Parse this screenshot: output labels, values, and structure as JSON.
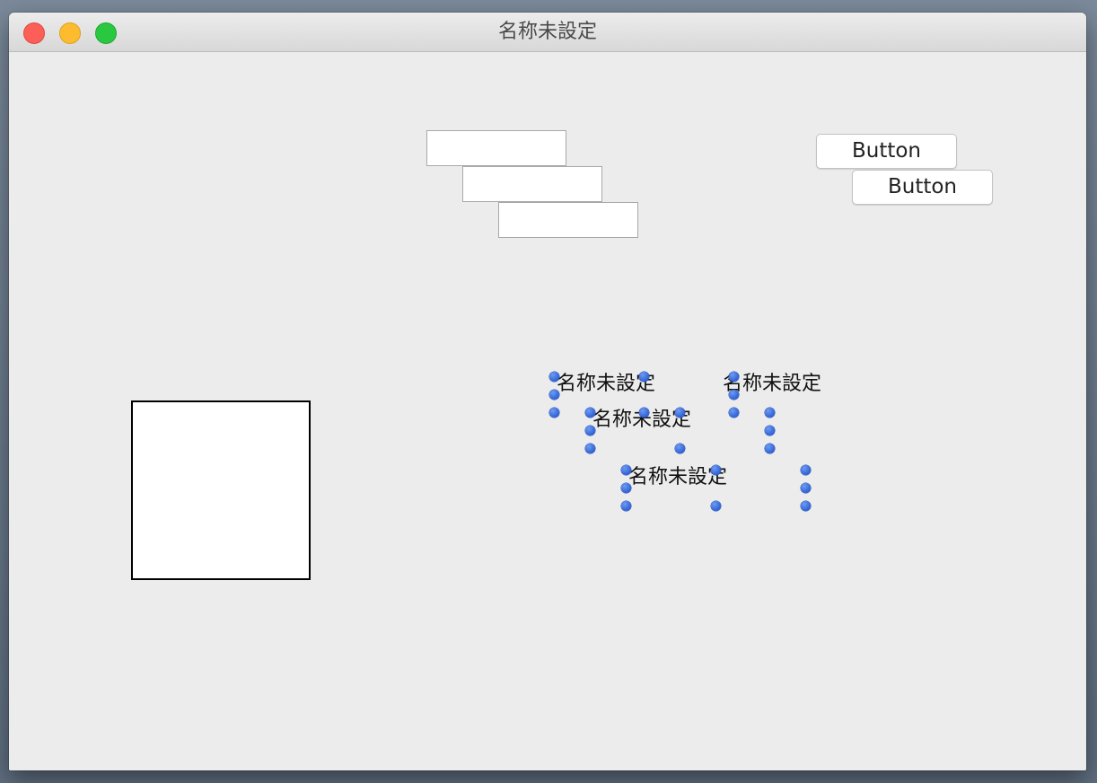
{
  "window": {
    "title": "名称未設定"
  },
  "buttons": {
    "button_1": "Button",
    "button_2": "Button"
  },
  "labels": {
    "label_1": "名称未設定",
    "label_2": "名称未設定",
    "label_3": "名称未設定",
    "label_4": "名称未設定"
  },
  "colors": {
    "window_background": "#ececec",
    "selection_handle": "#3b6fe0",
    "close": "#fc5f57",
    "minimize": "#fdbc2e",
    "zoom": "#2ac840"
  }
}
